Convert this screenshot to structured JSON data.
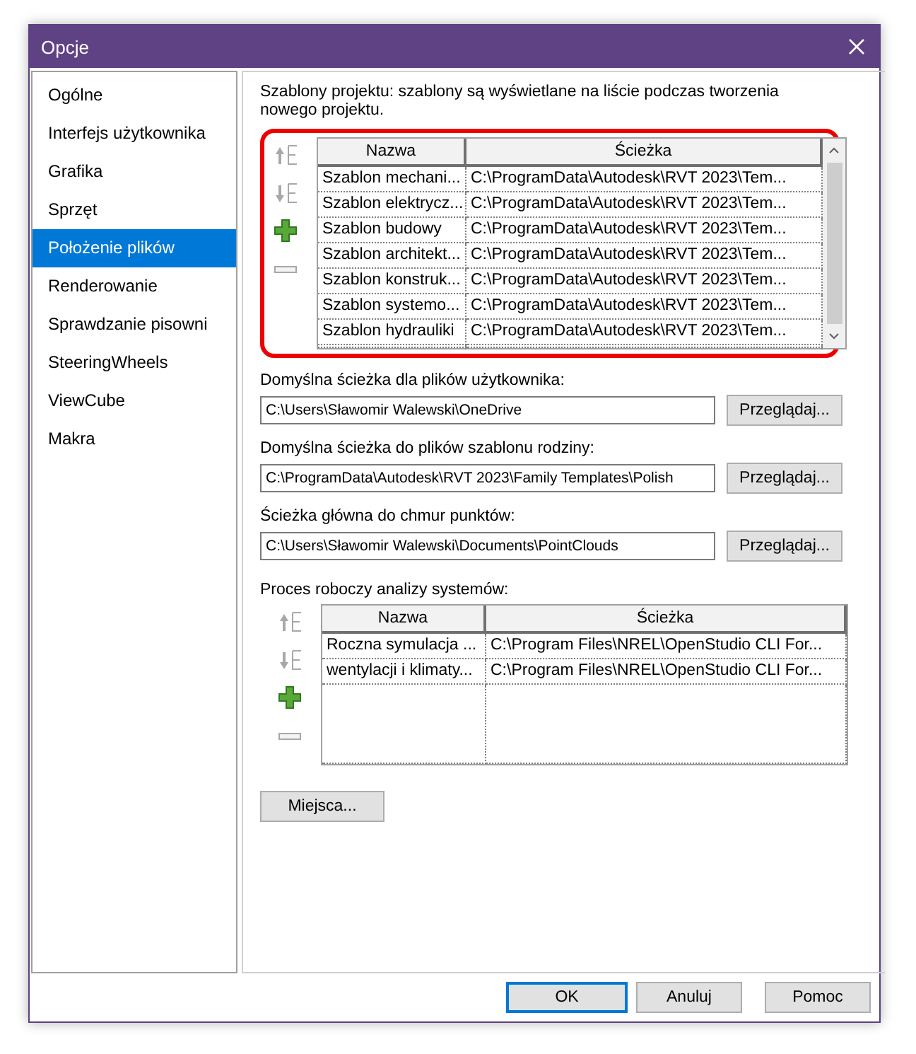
{
  "window": {
    "title": "Opcje"
  },
  "sidebar": {
    "items": [
      {
        "label": "Ogólne",
        "selected": false
      },
      {
        "label": "Interfejs użytkownika",
        "selected": false
      },
      {
        "label": "Grafika",
        "selected": false
      },
      {
        "label": "Sprzęt",
        "selected": false
      },
      {
        "label": "Położenie plików",
        "selected": true
      },
      {
        "label": "Renderowanie",
        "selected": false
      },
      {
        "label": "Sprawdzanie pisowni",
        "selected": false
      },
      {
        "label": "SteeringWheels",
        "selected": false
      },
      {
        "label": "ViewCube",
        "selected": false
      },
      {
        "label": "Makra",
        "selected": false
      }
    ]
  },
  "templates": {
    "description": "Szablony projektu: szablony są wyświetlane na liście podczas tworzenia nowego projektu.",
    "highlighted": true,
    "tools": [
      {
        "kind": "up",
        "disabled": true
      },
      {
        "kind": "down",
        "disabled": true
      },
      {
        "kind": "add",
        "disabled": false
      },
      {
        "kind": "remove",
        "disabled": true
      }
    ],
    "columns": [
      "Nazwa",
      "Ścieżka"
    ],
    "rows": [
      {
        "name": "Szablon mechani...",
        "path": "C:\\ProgramData\\Autodesk\\RVT 2023\\Tem..."
      },
      {
        "name": "Szablon elektrycz...",
        "path": "C:\\ProgramData\\Autodesk\\RVT 2023\\Tem..."
      },
      {
        "name": "Szablon budowy",
        "path": "C:\\ProgramData\\Autodesk\\RVT 2023\\Tem..."
      },
      {
        "name": "Szablon architekt...",
        "path": "C:\\ProgramData\\Autodesk\\RVT 2023\\Tem..."
      },
      {
        "name": "Szablon konstruk...",
        "path": "C:\\ProgramData\\Autodesk\\RVT 2023\\Tem..."
      },
      {
        "name": "Szablon systemo...",
        "path": "C:\\ProgramData\\Autodesk\\RVT 2023\\Tem..."
      },
      {
        "name": "Szablon hydrauliki",
        "path": "C:\\ProgramData\\Autodesk\\RVT 2023\\Tem..."
      }
    ]
  },
  "paths": [
    {
      "label": "Domyślna ścieżka dla plików użytkownika:",
      "value": "C:\\Users\\Sławomir Walewski\\OneDrive",
      "button": "Przeglądaj..."
    },
    {
      "label": "Domyślna ścieżka do plików szablonu rodziny:",
      "value": "C:\\ProgramData\\Autodesk\\RVT 2023\\Family Templates\\Polish",
      "button": "Przeglądaj..."
    },
    {
      "label": "Ścieżka główna do chmur punktów:",
      "value": "C:\\Users\\Sławomir Walewski\\Documents\\PointClouds",
      "button": "Przeglądaj..."
    }
  ],
  "analysis": {
    "label": "Proces roboczy analizy systemów:",
    "tools": [
      {
        "kind": "up",
        "disabled": true
      },
      {
        "kind": "down",
        "disabled": true
      },
      {
        "kind": "add",
        "disabled": false
      },
      {
        "kind": "remove",
        "disabled": true
      }
    ],
    "columns": [
      "Nazwa",
      "Ścieżka"
    ],
    "rows": [
      {
        "name": "Roczna symulacja ...",
        "path": "C:\\Program Files\\NREL\\OpenStudio CLI For..."
      },
      {
        "name": "wentylacji i klimaty...",
        "path": "C:\\Program Files\\NREL\\OpenStudio CLI For..."
      }
    ]
  },
  "places_button": "Miejsca...",
  "buttons": [
    {
      "label": "OK",
      "default": true
    },
    {
      "label": "Anuluj",
      "default": false
    },
    {
      "label": "Pomoc",
      "default": false
    }
  ]
}
